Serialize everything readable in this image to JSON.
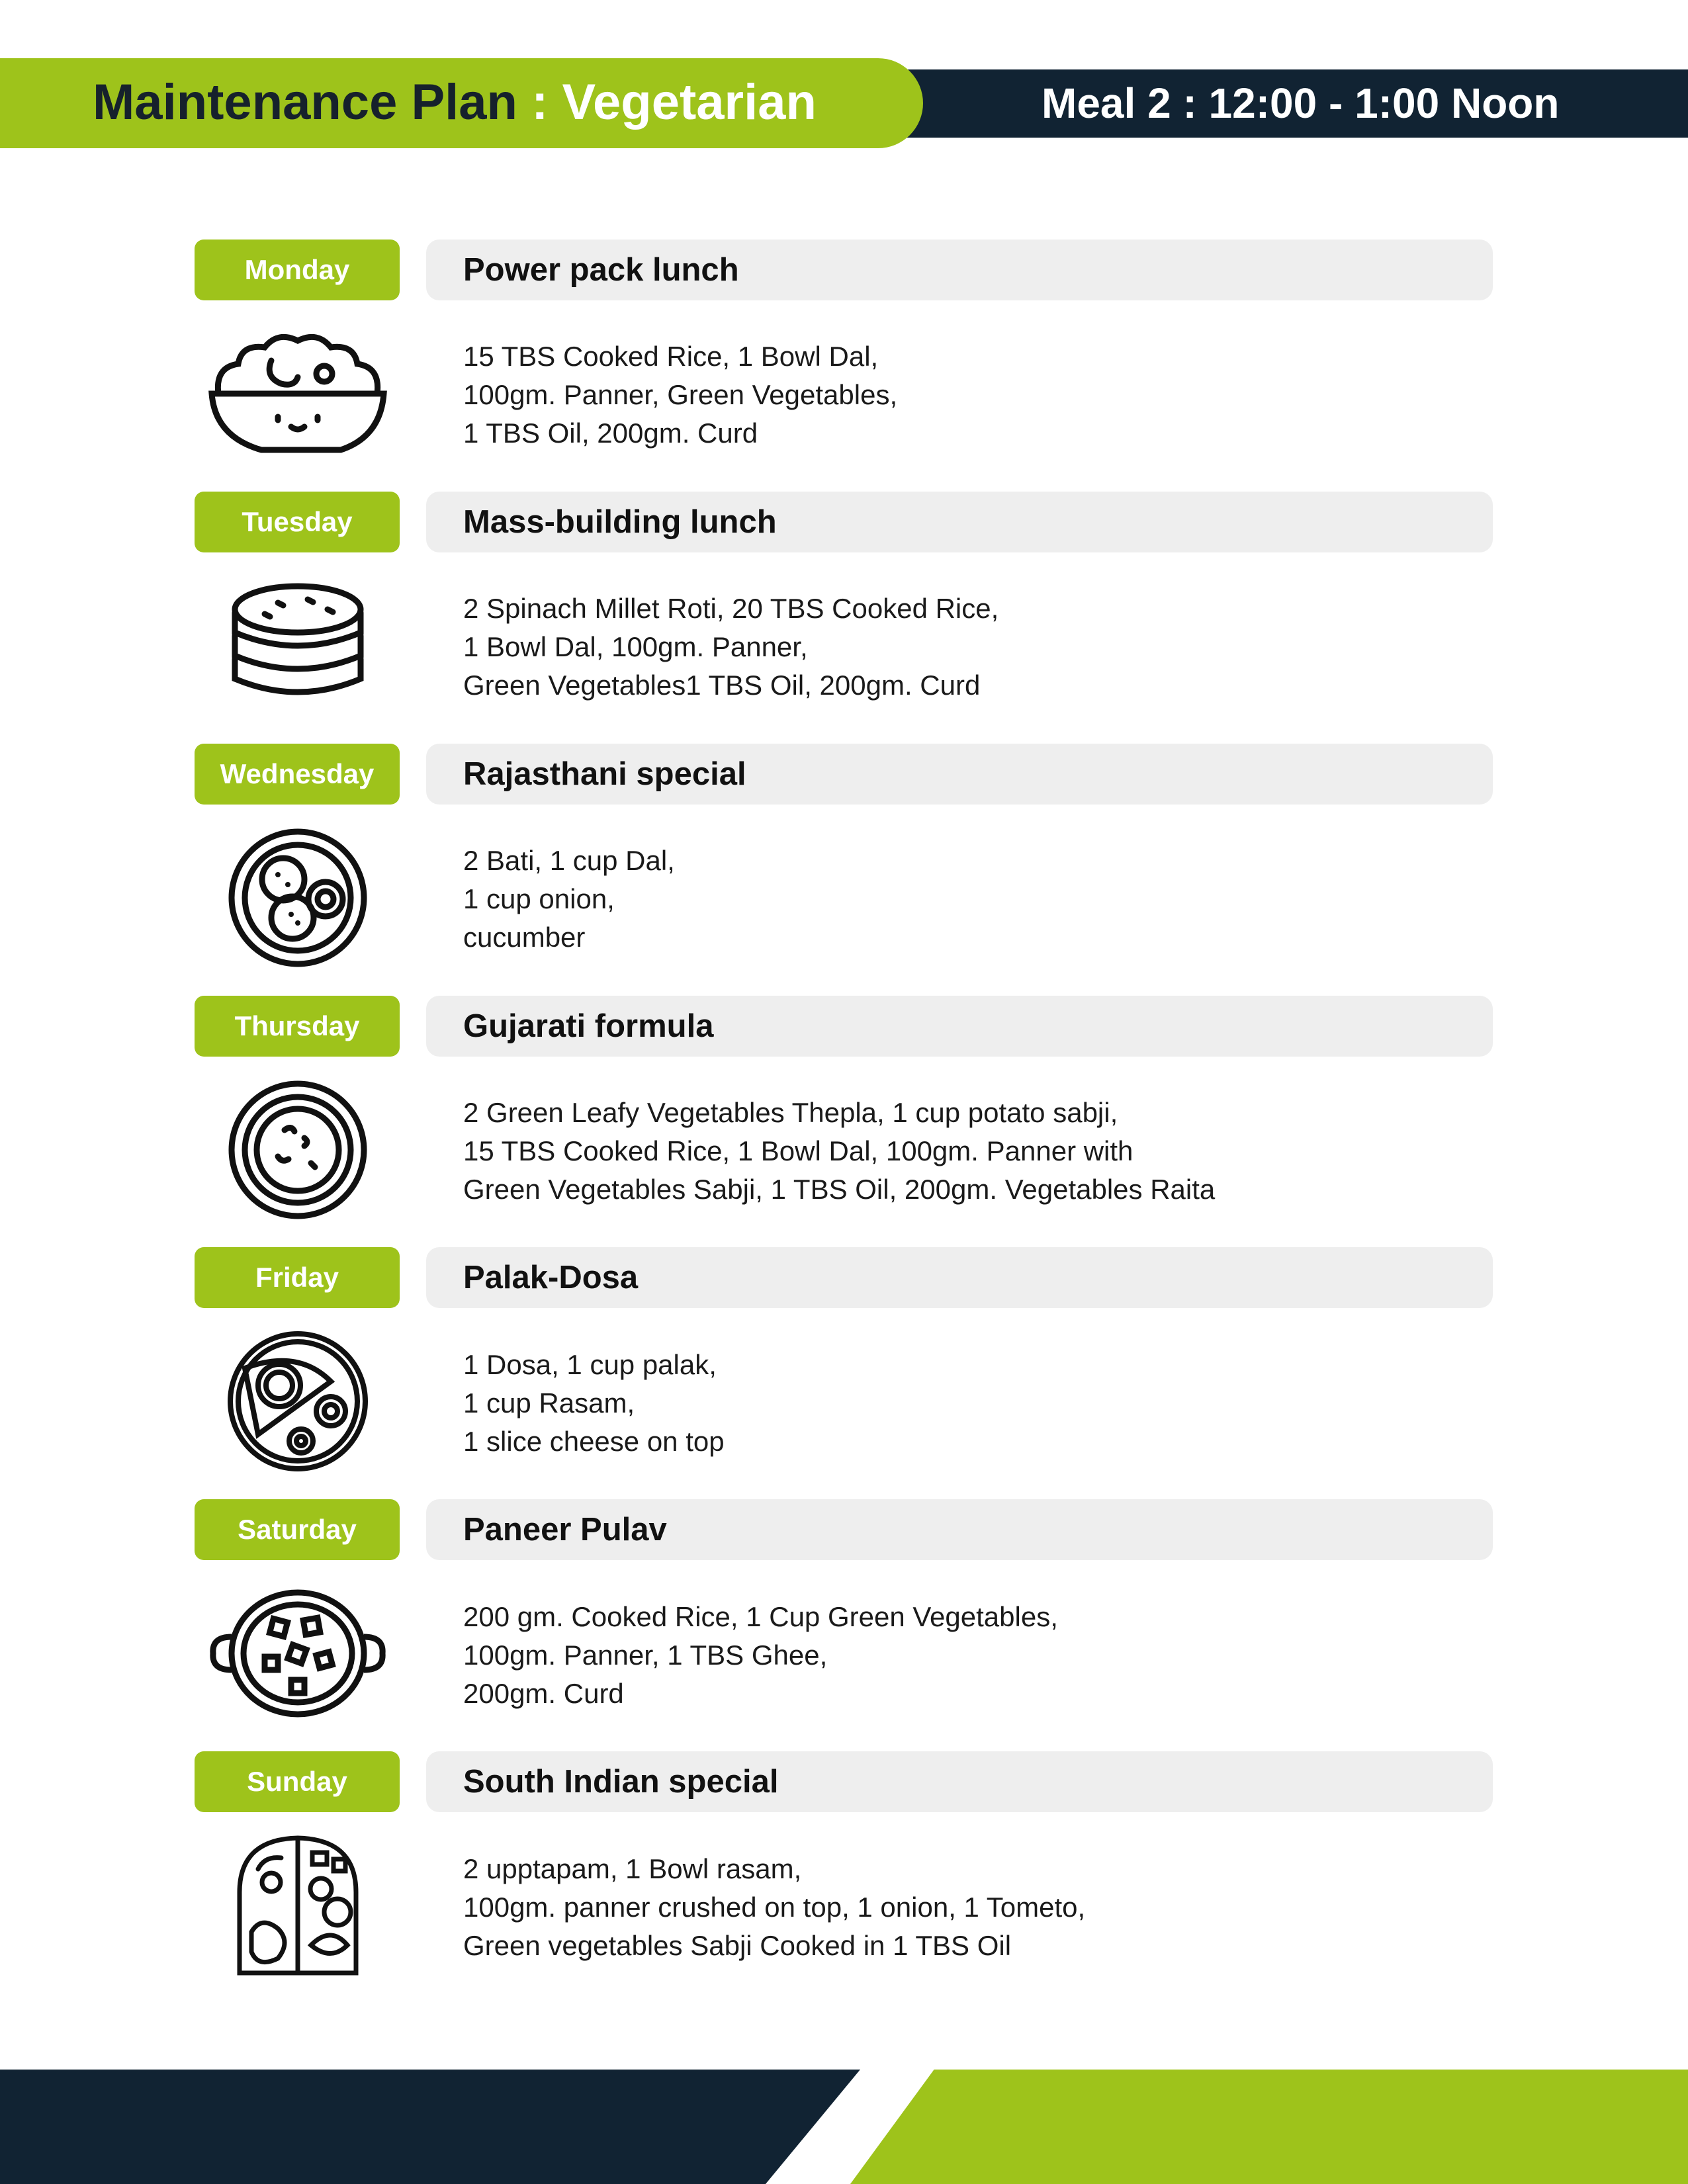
{
  "header": {
    "plan_label": "Maintenance Plan",
    "separator": " : ",
    "diet": "Vegetarian",
    "meal_time": "Meal 2 : 12:00 - 1:00 Noon"
  },
  "days": [
    {
      "day": "Monday",
      "title": "Power pack lunch",
      "icon": "rice-bowl-icon",
      "lines": [
        "15 TBS Cooked Rice, 1 Bowl Dal,",
        "100gm. Panner, Green Vegetables,",
        "1 TBS Oil, 200gm. Curd"
      ]
    },
    {
      "day": "Tuesday",
      "title": "Mass-building lunch",
      "icon": "roti-stack-icon",
      "lines": [
        "2 Spinach Millet Roti, 20 TBS Cooked Rice,",
        "1 Bowl Dal, 100gm. Panner,",
        "Green Vegetables1 TBS Oil, 200gm. Curd"
      ]
    },
    {
      "day": "Wednesday",
      "title": "Rajasthani special",
      "icon": "bati-plate-icon",
      "lines": [
        "2 Bati, 1 cup Dal,",
        "1 cup onion,",
        "cucumber"
      ]
    },
    {
      "day": "Thursday",
      "title": "Gujarati formula",
      "icon": "thepla-plate-icon",
      "lines": [
        "2 Green Leafy Vegetables Thepla, 1 cup potato sabji,",
        "15 TBS Cooked Rice, 1 Bowl Dal, 100gm. Panner with",
        "Green Vegetables Sabji, 1 TBS Oil, 200gm. Vegetables Raita"
      ]
    },
    {
      "day": "Friday",
      "title": "Palak-Dosa",
      "icon": "dosa-plate-icon",
      "lines": [
        "1 Dosa, 1 cup palak,",
        "1 cup Rasam,",
        "1 slice cheese on top"
      ]
    },
    {
      "day": "Saturday",
      "title": "Paneer Pulav",
      "icon": "pulav-pot-icon",
      "lines": [
        "200 gm. Cooked Rice, 1 Cup Green Vegetables,",
        "100gm. Panner, 1 TBS Ghee,",
        "200gm. Curd"
      ]
    },
    {
      "day": "Sunday",
      "title": "South Indian special",
      "icon": "thali-icon",
      "lines": [
        "2 upptapam, 1 Bowl rasam,",
        "100gm. panner crushed on top, 1 onion, 1 Tometo,",
        "Green vegetables Sabji Cooked in 1 TBS Oil"
      ]
    }
  ],
  "colors": {
    "accent_green": "#9ec31b",
    "dark_navy": "#112333",
    "bar_gray": "#eeeeee"
  }
}
